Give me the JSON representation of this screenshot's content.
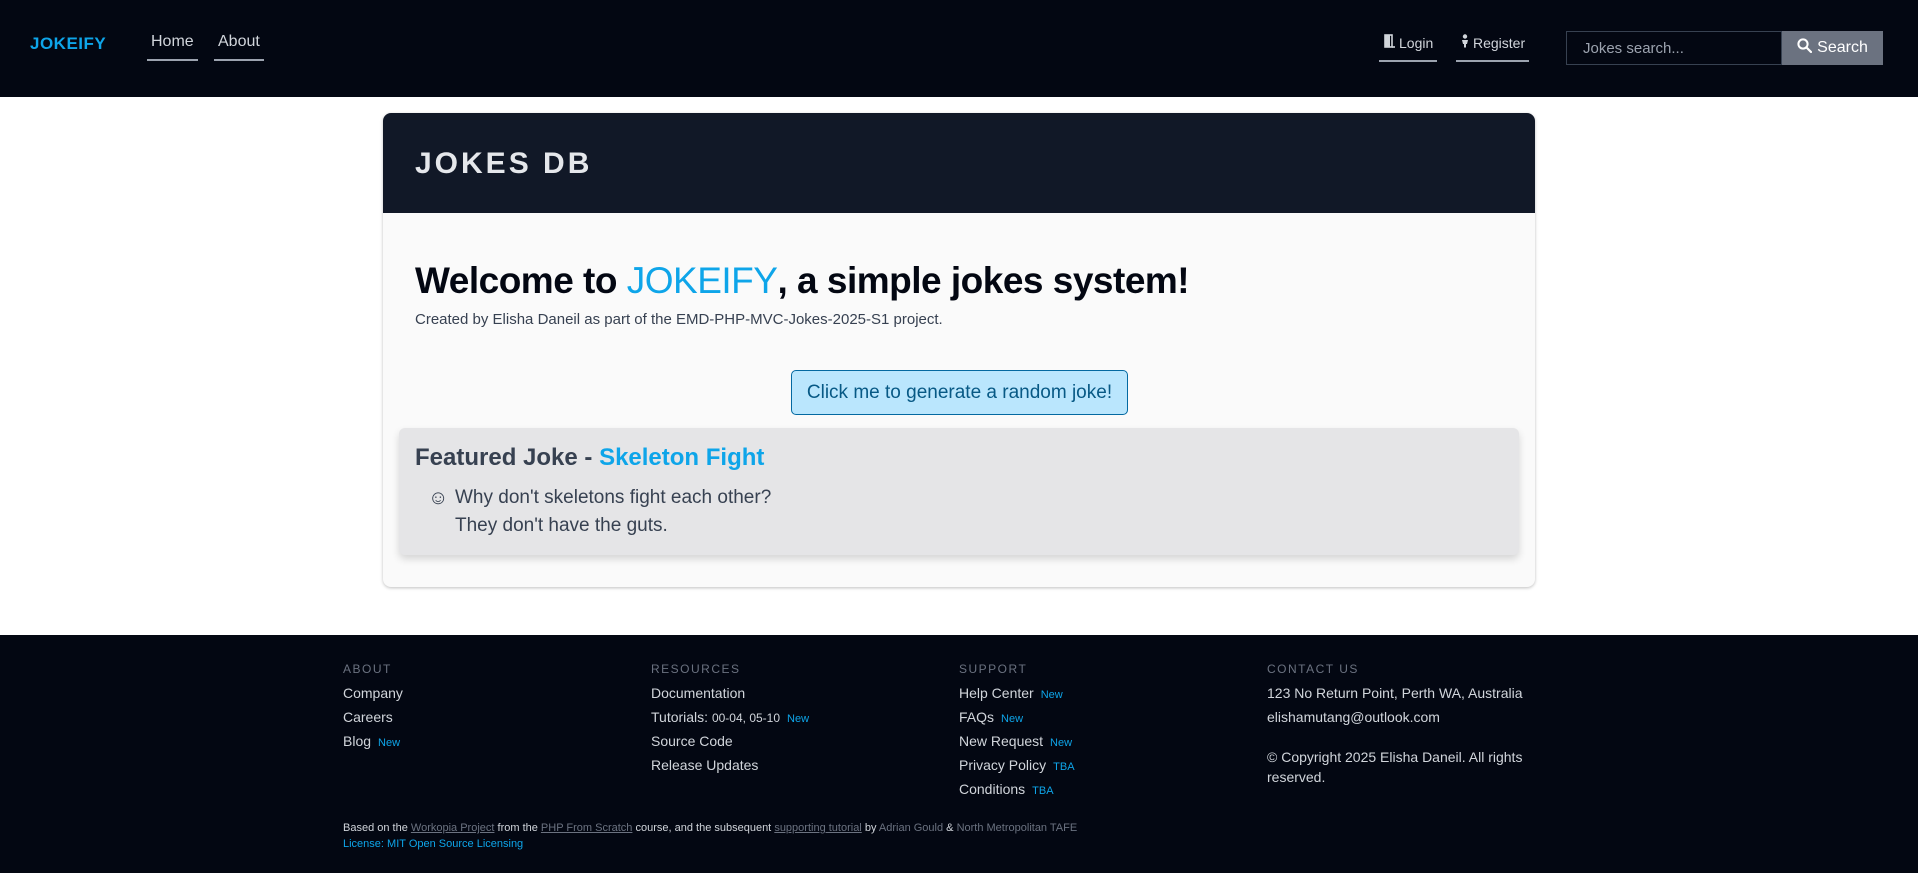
{
  "nav": {
    "brand": "JOKEIFY",
    "home": "Home",
    "about": "About",
    "login": "Login",
    "register": "Register",
    "search_placeholder": "Jokes search...",
    "search_button": "Search"
  },
  "card": {
    "title": "JOKES DB",
    "welcome_prefix": "Welcome to ",
    "welcome_brand": "JOKEIFY",
    "welcome_suffix": ", a simple jokes system!",
    "created": "Created by Elisha Daneil as part of the EMD-PHP-MVC-Jokes-2025-S1 project.",
    "generate_button": "Click me to generate a random joke!"
  },
  "featured": {
    "prefix": "Featured Joke - ",
    "title": "Skeleton Fight",
    "icon": "☺",
    "line1": "Why don't skeletons fight each other?",
    "line2": "They don't have the guts."
  },
  "footer": {
    "about": {
      "heading": "ABOUT",
      "items": [
        {
          "label": "Company",
          "badge": ""
        },
        {
          "label": "Careers",
          "badge": ""
        },
        {
          "label": "Blog",
          "badge": "New"
        }
      ]
    },
    "resources": {
      "heading": "RESOURCES",
      "documentation": "Documentation",
      "tutorials_label": "Tutorials:",
      "tutorials_value": "00-04, 05-10",
      "tutorials_badge": "New",
      "source_code": "Source Code",
      "release_updates": "Release Updates"
    },
    "support": {
      "heading": "SUPPORT",
      "items": [
        {
          "label": "Help Center",
          "badge": "New"
        },
        {
          "label": "FAQs",
          "badge": "New"
        },
        {
          "label": "New Request",
          "badge": "New"
        },
        {
          "label": "Privacy Policy",
          "badge": "TBA"
        },
        {
          "label": "Conditions",
          "badge": "TBA"
        }
      ]
    },
    "contact": {
      "heading": "CONTACT US",
      "address": "123 No Return Point, Perth WA, Australia",
      "email": "elishamutang@outlook.com",
      "copyright": "© Copyright 2025 Elisha Daneil. All rights reserved."
    },
    "credits": {
      "t1": "Based on the ",
      "link1": "Workopia Project",
      "t2": " from the ",
      "link2": "PHP From Scratch",
      "t3": " course, and the subsequent ",
      "link3": "supporting tutorial",
      "t4": " by ",
      "author": "Adrian Gould",
      "t5": " & ",
      "org": "North Metropolitan TAFE",
      "license": "License: MIT Open Source Licensing"
    }
  },
  "colors": {
    "accent": "#0ea5e9",
    "nav_bg": "#030712",
    "card_header_bg": "#111827"
  }
}
